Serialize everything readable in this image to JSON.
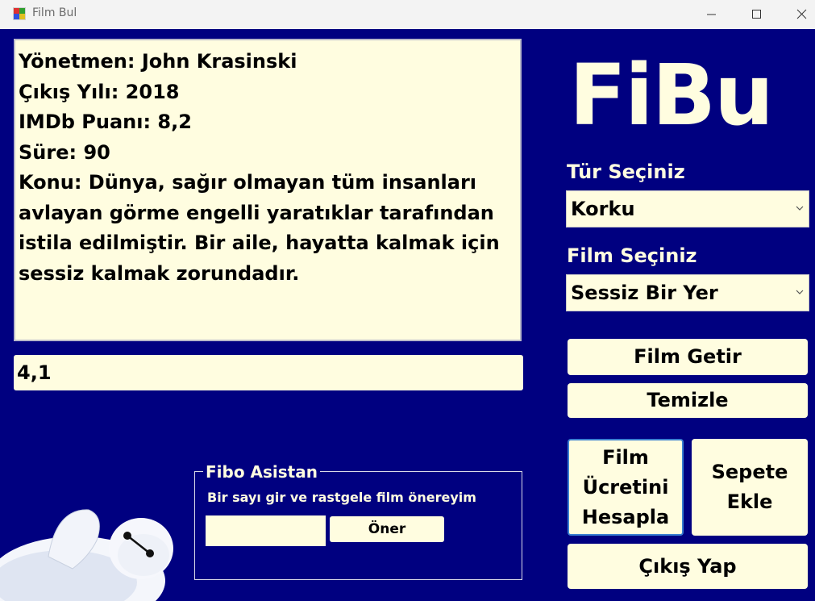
{
  "window": {
    "title": "Film Bul"
  },
  "info": {
    "director": "Yönetmen: John Krasinski",
    "year": "Çıkış Yılı: 2018",
    "imdb": "IMDb Puanı: 8,2",
    "duration": "Süre: 90",
    "plot": "Konu: Dünya, sağır olmayan tüm insanları avlayan görme engelli yaratıklar tarafından istila edilmiştir. Bir aile, hayatta kalmak için sessiz kalmak zorundadır."
  },
  "result": {
    "value": "4,1"
  },
  "logo": "FiBu",
  "genre": {
    "label": "Tür Seçiniz",
    "selected": "Korku"
  },
  "film": {
    "label": "Film Seçiniz",
    "selected": "Sessiz Bir Yer"
  },
  "buttons": {
    "get_film": "Film Getir",
    "clear": "Temizle",
    "calc_price": "Film Ücretini Hesapla",
    "add_cart": "Sepete Ekle",
    "exit": "Çıkış Yap"
  },
  "assistant": {
    "title": "Fibo Asistan",
    "hint": "Bir sayı gir ve rastgele film önereyim",
    "input_value": "",
    "suggest_button": "Öner"
  }
}
